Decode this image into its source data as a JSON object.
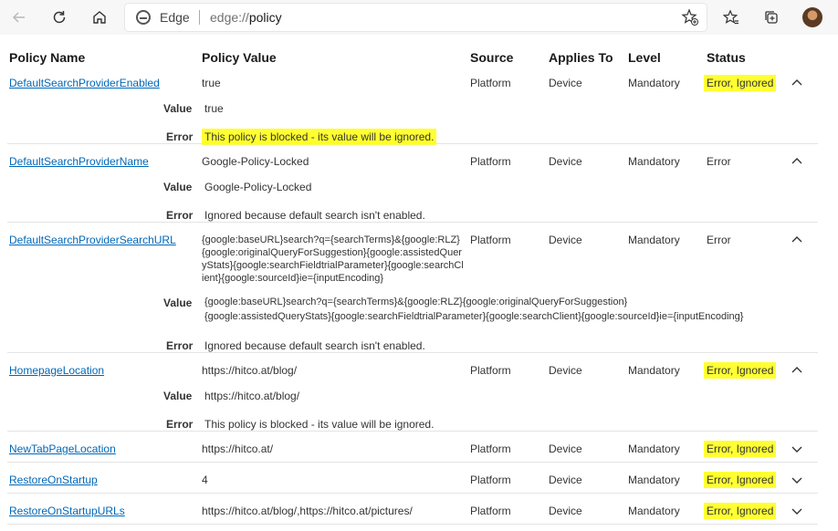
{
  "browser": {
    "app_name": "Edge",
    "url_scheme": "edge://",
    "url_host": "policy"
  },
  "columns": [
    "Policy Name",
    "Policy Value",
    "Source",
    "Applies To",
    "Level",
    "Status"
  ],
  "labels": {
    "value": "Value",
    "error": "Error"
  },
  "policies": [
    {
      "name": "DefaultSearchProviderEnabled",
      "value": "true",
      "source": "Platform",
      "applies_to": "Device",
      "level": "Mandatory",
      "status": "Error, Ignored",
      "detail_value": "true",
      "detail_error": "This policy is blocked - its value will be ignored.",
      "expanded": true
    },
    {
      "name": "DefaultSearchProviderName",
      "value": "Google-Policy-Locked",
      "source": "Platform",
      "applies_to": "Device",
      "level": "Mandatory",
      "status": "Error",
      "detail_value": "Google-Policy-Locked",
      "detail_error": "Ignored because default search isn't enabled.",
      "expanded": true
    },
    {
      "name": "DefaultSearchProviderSearchURL",
      "value": "{google:baseURL}search?q={searchTerms}&{google:RLZ}{google:originalQueryForSuggestion}{google:assistedQueryStats}{google:searchFieldtrialParameter}{google:searchClient}{google:sourceId}ie={inputEncoding}",
      "source": "Platform",
      "applies_to": "Device",
      "level": "Mandatory",
      "status": "Error",
      "detail_value_line1": "{google:baseURL}search?q={searchTerms}&{google:RLZ}{google:originalQueryForSuggestion}",
      "detail_value_line2": "{google:assistedQueryStats}{google:searchFieldtrialParameter}{google:searchClient}{google:sourceId}ie={inputEncoding}",
      "detail_error": "Ignored because default search isn't enabled.",
      "expanded": true
    },
    {
      "name": "HomepageLocation",
      "value": "https://hitco.at/blog/",
      "source": "Platform",
      "applies_to": "Device",
      "level": "Mandatory",
      "status": "Error, Ignored",
      "detail_value": "https://hitco.at/blog/",
      "detail_error": "This policy is blocked - its value will be ignored.",
      "expanded": true
    },
    {
      "name": "NewTabPageLocation",
      "value": "https://hitco.at/",
      "source": "Platform",
      "applies_to": "Device",
      "level": "Mandatory",
      "status": "Error, Ignored",
      "expanded": false
    },
    {
      "name": "RestoreOnStartup",
      "value": "4",
      "source": "Platform",
      "applies_to": "Device",
      "level": "Mandatory",
      "status": "Error, Ignored",
      "expanded": false
    },
    {
      "name": "RestoreOnStartupURLs",
      "value": "https://hitco.at/blog/,https://hitco.at/pictures/",
      "source": "Platform",
      "applies_to": "Device",
      "level": "Mandatory",
      "status": "Error, Ignored",
      "expanded": false
    }
  ],
  "colors": {
    "highlight": "#ffff32",
    "link": "#0067b8"
  }
}
